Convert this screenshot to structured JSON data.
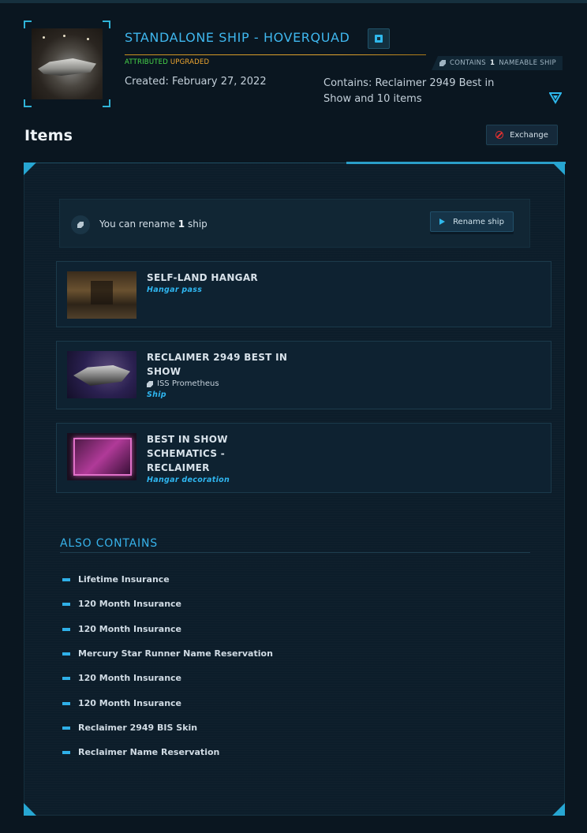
{
  "package": {
    "title": "STANDALONE SHIP - HOVERQUAD",
    "tag_attributed": "ATTRIBUTED",
    "tag_upgraded": "UPGRADED",
    "nameable_prefix": "CONTAINS",
    "nameable_count": "1",
    "nameable_suffix": "NAMEABLE SHIP",
    "created": "Created: February 27, 2022",
    "contains": "Contains: Reclaimer 2949 Best in Show and 10 items"
  },
  "items_section": {
    "heading": "Items",
    "exchange_label": "Exchange"
  },
  "rename": {
    "text_prefix": "You can rename",
    "count": "1",
    "text_suffix": "ship",
    "button_label": "Rename ship"
  },
  "items": [
    {
      "name": "SELF-LAND HANGAR",
      "type": "Hangar pass",
      "sub": ""
    },
    {
      "name": "RECLAIMER 2949 BEST IN SHOW",
      "type": "Ship",
      "sub": "ISS Prometheus"
    },
    {
      "name": "BEST IN SHOW SCHEMATICS - RECLAIMER",
      "type": "Hangar decoration",
      "sub": ""
    }
  ],
  "also_contains": {
    "heading": "ALSO CONTAINS",
    "items": [
      "Lifetime Insurance",
      "120 Month Insurance",
      "120 Month Insurance",
      "Mercury Star Runner Name Reservation",
      "120 Month Insurance",
      "120 Month Insurance",
      "Reclaimer 2949 BIS Skin",
      "Reclaimer Name Reservation"
    ]
  },
  "colors": {
    "accent": "#2fb8ec",
    "attributed": "#48d84a",
    "upgraded": "#f2a830",
    "danger": "#e53030"
  }
}
